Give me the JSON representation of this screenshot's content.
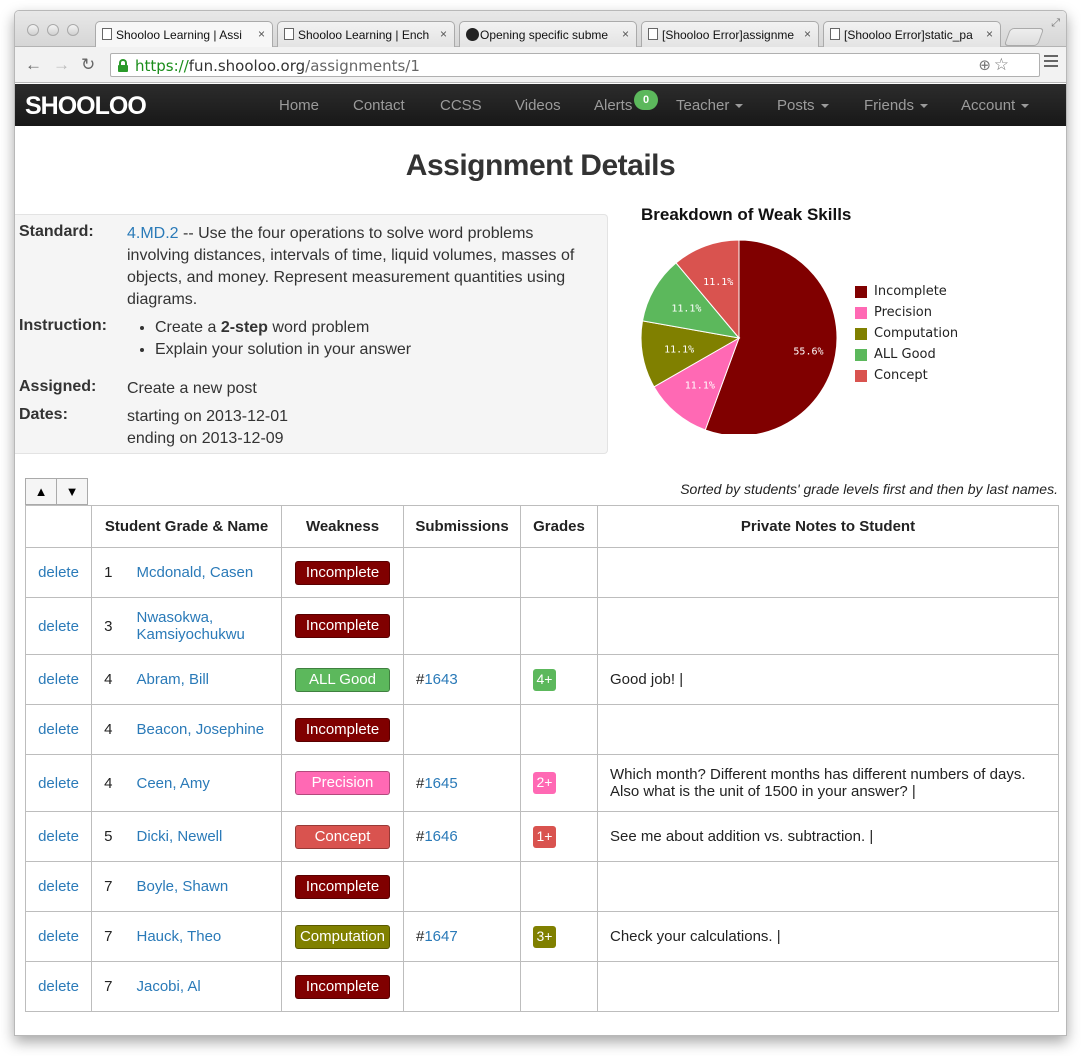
{
  "browser": {
    "tabs": [
      {
        "label": "Shooloo Learning | Assi",
        "icon": "page-icon",
        "active": true
      },
      {
        "label": "Shooloo Learning | Ench",
        "icon": "page-icon",
        "active": false
      },
      {
        "label": "Opening specific subme",
        "icon": "github-icon",
        "active": false
      },
      {
        "label": "[Shooloo Error]assignme",
        "icon": "page-icon",
        "active": false
      },
      {
        "label": "[Shooloo Error]static_pa",
        "icon": "page-icon",
        "active": false
      }
    ],
    "url_scheme": "https://",
    "url_host": "fun.shooloo.org",
    "url_path": "/assignments/1"
  },
  "navbar": {
    "brand": "SHOOLOO",
    "items": [
      {
        "label": "Home",
        "dropdown": false
      },
      {
        "label": "Contact",
        "dropdown": false
      },
      {
        "label": "CCSS",
        "dropdown": false
      },
      {
        "label": "Videos",
        "dropdown": false
      },
      {
        "label": "Alerts",
        "dropdown": false
      },
      {
        "label": "Teacher",
        "dropdown": true
      },
      {
        "label": "Posts",
        "dropdown": true
      },
      {
        "label": "Friends",
        "dropdown": true
      },
      {
        "label": "Account",
        "dropdown": true
      }
    ],
    "alerts_count": "0"
  },
  "page": {
    "title": "Assignment Details"
  },
  "details": {
    "standard_label": "Standard:",
    "standard_code": "4.MD.2",
    "standard_text": " -- Use the four operations to solve word problems involving distances, intervals of time, liquid volumes, masses of objects, and money. Represent measurement quantities using diagrams.",
    "instruction_label": "Instruction:",
    "instruction_1_pre": "Create a ",
    "instruction_1_bold": "2-step",
    "instruction_1_post": " word problem",
    "instruction_2": "Explain your solution in your answer",
    "assigned_label": "Assigned:",
    "assigned_value": "Create a new post",
    "dates_label": "Dates:",
    "start": "starting on 2013-12-01",
    "end": "ending on 2013-12-09"
  },
  "chart_data": {
    "type": "pie",
    "title": "Breakdown of Weak Skills",
    "slices": [
      {
        "label": "Incomplete",
        "value": 55.6,
        "display": "55.6%",
        "color": "#800000"
      },
      {
        "label": "Precision",
        "value": 11.1,
        "display": "11.1%",
        "color": "#ff69b4"
      },
      {
        "label": "Computation",
        "value": 11.1,
        "display": "11.1%",
        "color": "#808000"
      },
      {
        "label": "ALL Good",
        "value": 11.1,
        "display": "11.1%",
        "color": "#5cb85c"
      },
      {
        "label": "Concept",
        "value": 11.1,
        "display": "11.1%",
        "color": "#d9534f"
      }
    ],
    "legend_position": "right"
  },
  "table": {
    "sort_up": "▲",
    "sort_down": "▼",
    "sort_note": "Sorted by students' grade levels first and then by last names.",
    "headers": {
      "name": "Student Grade & Name",
      "weakness": "Weakness",
      "submissions": "Submissions",
      "grades": "Grades",
      "notes": "Private Notes to Student"
    },
    "rows": [
      {
        "delete": "delete",
        "grade": "1",
        "name": "Mcdonald, Casen",
        "weakness": "Incomplete",
        "submission": "",
        "grade_badge": "",
        "note": ""
      },
      {
        "delete": "delete",
        "grade": "3",
        "name": "Nwasokwa, Kamsiyochukwu",
        "weakness": "Incomplete",
        "submission": "",
        "grade_badge": "",
        "note": ""
      },
      {
        "delete": "delete",
        "grade": "4",
        "name": "Abram, Bill",
        "weakness": "ALL Good",
        "submission": "1643",
        "grade_badge": "4+",
        "note": "Good job! |"
      },
      {
        "delete": "delete",
        "grade": "4",
        "name": "Beacon, Josephine",
        "weakness": "Incomplete",
        "submission": "",
        "grade_badge": "",
        "note": ""
      },
      {
        "delete": "delete",
        "grade": "4",
        "name": "Ceen, Amy",
        "weakness": "Precision",
        "submission": "1645",
        "grade_badge": "2+",
        "note": "Which month? Different months has different numbers of days. Also what is the unit of 1500 in your answer? |"
      },
      {
        "delete": "delete",
        "grade": "5",
        "name": "Dicki, Newell",
        "weakness": "Concept",
        "submission": "1646",
        "grade_badge": "1+",
        "note": "See me about addition vs. subtraction. |"
      },
      {
        "delete": "delete",
        "grade": "7",
        "name": "Boyle, Shawn",
        "weakness": "Incomplete",
        "submission": "",
        "grade_badge": "",
        "note": ""
      },
      {
        "delete": "delete",
        "grade": "7",
        "name": "Hauck, Theo",
        "weakness": "Computation",
        "submission": "1647",
        "grade_badge": "3+",
        "note": "Check your calculations. |"
      },
      {
        "delete": "delete",
        "grade": "7",
        "name": "Jacobi, Al",
        "weakness": "Incomplete",
        "submission": "",
        "grade_badge": "",
        "note": ""
      }
    ]
  }
}
